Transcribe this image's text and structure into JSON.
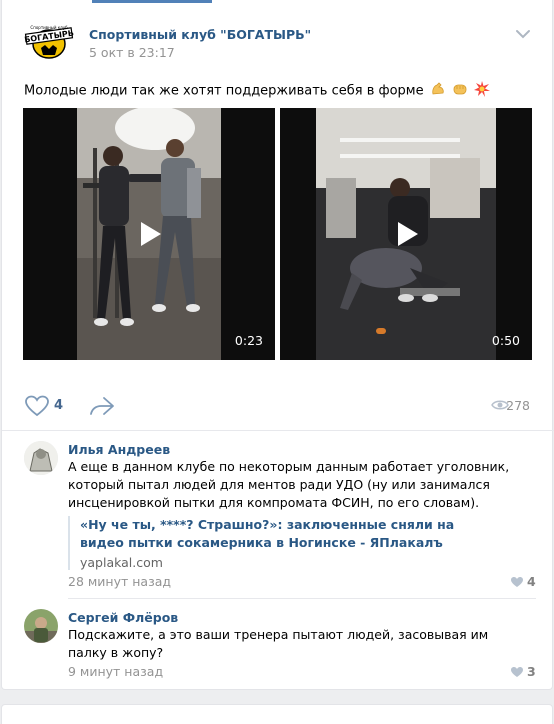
{
  "post": {
    "group_name": "Спортивный клуб \"БОГАТЫРЬ\"",
    "date": "5 окт в 23:17",
    "text": "Молодые люди так же хотят поддерживать себя в форме",
    "emojis": [
      "flexed-biceps",
      "fist",
      "collision"
    ],
    "logo_text": [
      "Спортивный клуб",
      "БОГАТЫРЬ"
    ],
    "videos": [
      {
        "duration": "0:23"
      },
      {
        "duration": "0:50"
      }
    ],
    "likes": "4",
    "views": "278"
  },
  "comments": [
    {
      "author": "Илья Андреев",
      "text": "А еще в данном клубе по некоторым данным работает уголовник, который пытал людей для ментов ради УДО (ну или занимался инсценировкой пытки для компромата ФСИН, по его словам).",
      "link_title": "«Ну че ты, ****? Страшно?»: заключенные сняли на видео пытки сокамерника в Ногинске - ЯПлакалъ",
      "link_domain": "yaplakal.com",
      "time": "28 минут назад",
      "likes": "4"
    },
    {
      "author": "Сергей Флёров",
      "text": "Подскажите, а это ваши тренера пытают людей, засовывая им палку в жопу?",
      "time": "9 минут назад",
      "likes": "3"
    }
  ],
  "colors": {
    "link": "#2a5885",
    "muted": "#939393",
    "background": "#edeef0",
    "logo_yellow": "#f2c200"
  }
}
